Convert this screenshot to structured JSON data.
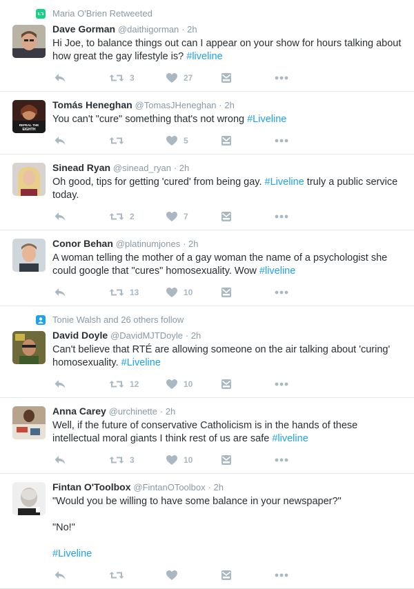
{
  "icon_colors": {
    "action": "#aab8c2",
    "hashtag": "#1da1f2",
    "retweet_context": "#19cf86",
    "follow_context": "#1da1f2"
  },
  "tweets": [
    {
      "context": "Maria O'Brien Retweeted",
      "context_icon": "retweet-icon",
      "name": "Dave Gorman",
      "handle": "@daithigorman",
      "time": "· 2h",
      "text_parts": [
        [
          "Hi Joe, to balance things out can I appear on your show for hours talking about how great the gay lifestyle is? ",
          "#liveline"
        ]
      ],
      "retweets": "3",
      "likes": "27"
    },
    {
      "name": "Tomás Heneghan",
      "handle": "@TomasJHeneghan",
      "time": "· 2h",
      "text_parts": [
        [
          "You can't \"cure\" something that's not wrong ",
          "#Liveline"
        ]
      ],
      "retweets": "",
      "likes": "5",
      "avatar_text": "REPEAL THE EIGHTH AMENDMENT"
    },
    {
      "name": "Sinead Ryan",
      "handle": "@sinead_ryan",
      "time": "· 2h",
      "text_parts": [
        [
          "Oh good, tips for getting 'cured' from being gay. ",
          "#Liveline",
          " truly a public service today."
        ]
      ],
      "retweets": "2",
      "likes": "7"
    },
    {
      "name": "Conor Behan",
      "handle": "@platinumjones",
      "time": "· 2h",
      "text_parts": [
        [
          "A woman telling the mother of a gay woman the name of a psychologist she could google that \"cures\" homosexuality. Wow ",
          "#liveline"
        ]
      ],
      "retweets": "13",
      "likes": "10"
    },
    {
      "context": "Tonie Walsh and 26 others follow",
      "context_icon": "person-icon",
      "name": "David Doyle",
      "handle": "@DavidMJTDoyle",
      "time": "· 2h",
      "text_parts": [
        [
          "Can't believe that RTÉ are allowing someone on the air talking about 'curing' homosexuality. ",
          "#Liveline"
        ]
      ],
      "retweets": "12",
      "likes": "10"
    },
    {
      "name": "Anna Carey",
      "handle": "@urchinette",
      "time": "· 2h",
      "text_parts": [
        [
          "Well, if the future of conservative Catholicism is in the hands of these intellectual moral giants I think rest of us are safe ",
          "#liveline"
        ]
      ],
      "retweets": "3",
      "likes": "10"
    },
    {
      "name": "Fintan O'Toolbox",
      "handle": "@FintanOToolbox",
      "time": "· 2h",
      "text_parts": [
        [
          "\"Would you be willing to have some balance in your newspaper?\""
        ],
        [
          "\"No!\""
        ],
        [
          "",
          "#Liveline"
        ]
      ],
      "retweets": "",
      "likes": ""
    }
  ]
}
